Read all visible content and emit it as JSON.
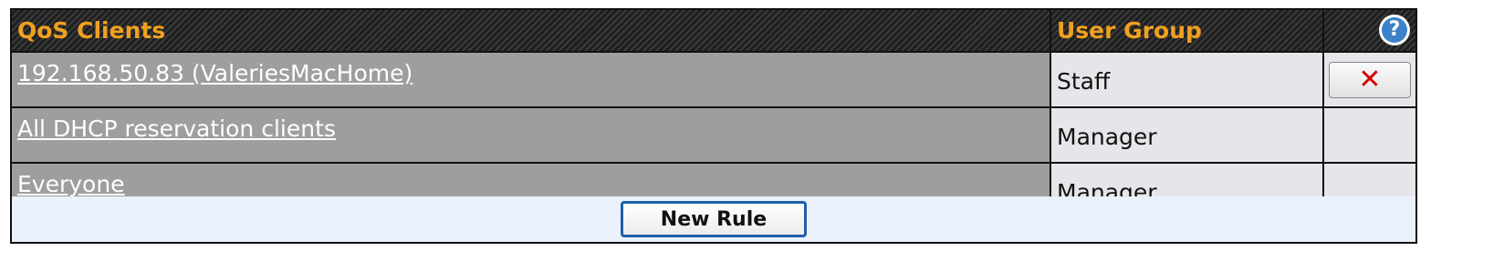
{
  "table": {
    "headers": {
      "client": "QoS Clients",
      "group": "User Group",
      "help_icon": "?"
    },
    "rows": [
      {
        "client": "192.168.50.83 (ValeriesMacHome)",
        "group": "Staff",
        "deletable": true,
        "delete_icon": "✕"
      },
      {
        "client": "All DHCP reservation clients",
        "group": "Manager",
        "deletable": false
      },
      {
        "client": "Everyone",
        "group": "Manager",
        "deletable": false
      }
    ]
  },
  "footer": {
    "new_rule_label": "New Rule"
  },
  "icons": {
    "help": "question-circle-icon",
    "delete": "red-x-icon"
  },
  "colors": {
    "header_text": "#f0a020",
    "client_bg": "#9e9e9e",
    "group_bg": "#e6e6ea",
    "button_border": "#1f5fa8",
    "delete_x": "#d40000"
  }
}
